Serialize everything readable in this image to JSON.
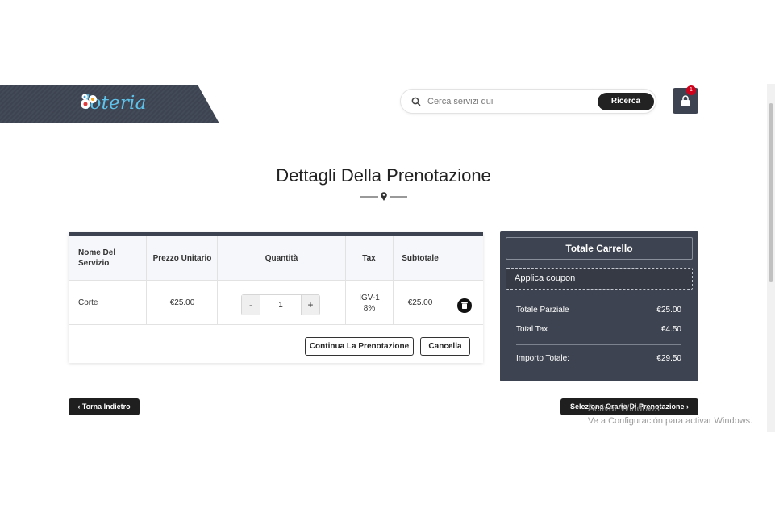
{
  "header": {
    "logo_text": "loteria",
    "search_placeholder": "Cerca servizi qui",
    "search_button": "Ricerca",
    "cart_count": "1"
  },
  "page": {
    "title": "Dettagli Della Prenotazione"
  },
  "table": {
    "headers": {
      "name": "Nome Del Servizio",
      "price": "Prezzo Unitario",
      "quantity": "Quantità",
      "tax": "Tax",
      "subtotal": "Subtotale"
    },
    "rows": [
      {
        "name": "Corte",
        "price": "€25.00",
        "quantity": "1",
        "qty_minus": "-",
        "qty_plus": "+",
        "tax": "IGV-18%",
        "subtotal": "€25.00"
      }
    ],
    "continue_button": "Continua La Prenotazione",
    "cancel_button": "Cancella"
  },
  "cart_total": {
    "title": "Totale Carrello",
    "coupon": "Applica coupon",
    "subtotal_label": "Totale Parziale",
    "subtotal_value": "€25.00",
    "tax_label": "Total Tax",
    "tax_value": "€4.50",
    "total_label": "Importo Totale:",
    "total_value": "€29.50"
  },
  "footer": {
    "back_button": "‹ Torna Indietro",
    "next_button": "Seleziona Orario Di Prenotazione  ›"
  },
  "watermark": {
    "line1": "Activar Windows",
    "line2": "Ve a Configuración para activar Windows."
  },
  "colors": {
    "dark_panel": "#3d4350",
    "logo_accent": "#5ec3ea",
    "badge": "#d0021b",
    "button_dark": "#1f1f1f"
  }
}
